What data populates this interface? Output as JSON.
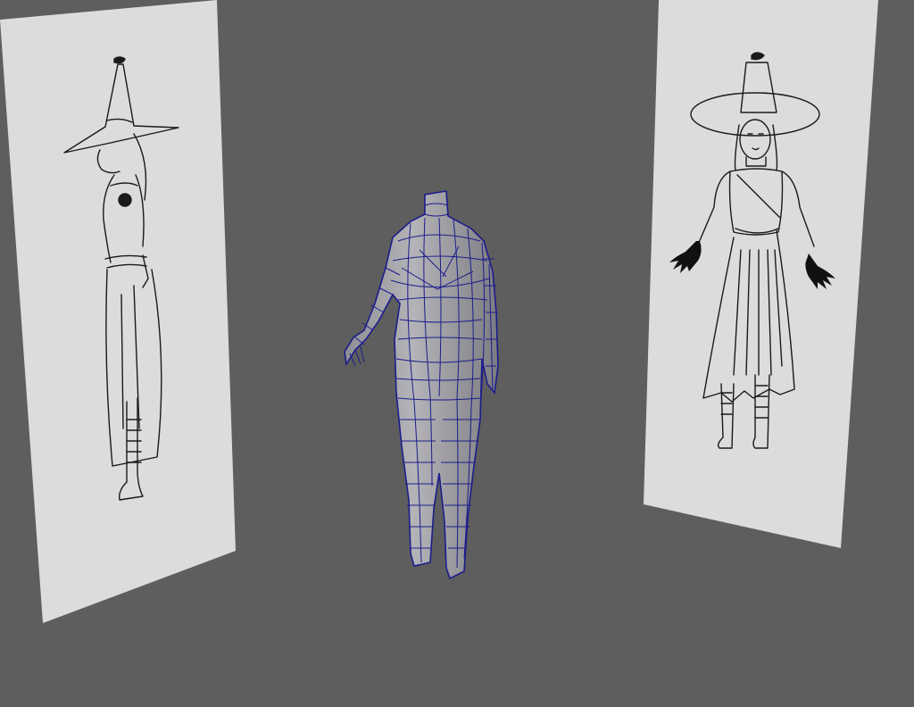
{
  "viewport": {
    "background": "#5e5e5e",
    "image_plane_color": "#dcdcdc",
    "wireframe_color": "#1c1c8c",
    "mesh_fill": "#a8a8ac"
  },
  "scene": {
    "left_plane": {
      "subject": "witch-side-view-sketch"
    },
    "right_plane": {
      "subject": "witch-front-view-sketch"
    },
    "mesh": {
      "subject": "headless-female-body-base-mesh",
      "display": "wireframe-on-shaded"
    }
  }
}
